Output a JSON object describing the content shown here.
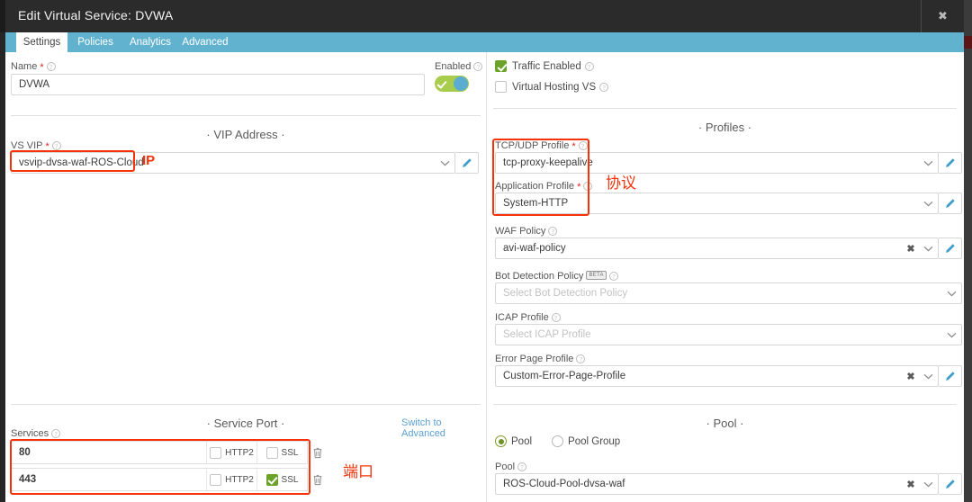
{
  "window": {
    "title": "Edit Virtual Service: DVWA",
    "close_label": "✖"
  },
  "tabs": [
    {
      "label": "Settings",
      "active": true
    },
    {
      "label": "Policies",
      "active": false
    },
    {
      "label": "Analytics",
      "active": false
    },
    {
      "label": "Advanced",
      "active": false
    }
  ],
  "name_field": {
    "label": "Name",
    "required": "*",
    "value": "DVWA"
  },
  "enabled_toggle": {
    "label": "Enabled",
    "state": "on"
  },
  "checkboxes": [
    {
      "label": "Traffic Enabled",
      "checked": true
    },
    {
      "label": "Virtual Hosting VS",
      "checked": false
    }
  ],
  "sections": {
    "vip_address": "VIP Address",
    "service_port": "Service Port",
    "profiles": "Profiles",
    "pool": "Pool"
  },
  "vs_vip": {
    "label": "VS VIP",
    "required": "*",
    "value": "vsvip-dvsa-waf-ROS-Cloud"
  },
  "service_port": {
    "services_label": "Services",
    "switch_link": "Switch to Advanced",
    "http2_label": "HTTP2",
    "ssl_label": "SSL",
    "rows": [
      {
        "port": "80",
        "http2": false,
        "ssl": false
      },
      {
        "port": "443",
        "http2": false,
        "ssl": true
      }
    ]
  },
  "profiles": {
    "tcp_udp": {
      "label": "TCP/UDP Profile",
      "required": "*",
      "value": "tcp-proxy-keepalive"
    },
    "application": {
      "label": "Application Profile",
      "required": "*",
      "value": "System-HTTP"
    },
    "waf_policy": {
      "label": "WAF Policy",
      "value": "avi-waf-policy"
    },
    "bot_detection": {
      "label": "Bot Detection Policy",
      "badge": "BETA",
      "placeholder": "Select Bot Detection Policy"
    },
    "icap": {
      "label": "ICAP Profile",
      "placeholder": "Select ICAP Profile"
    },
    "error_page": {
      "label": "Error Page Profile",
      "value": "Custom-Error-Page-Profile"
    }
  },
  "pool_section": {
    "radios": [
      {
        "label": "Pool",
        "selected": true
      },
      {
        "label": "Pool Group",
        "selected": false
      }
    ],
    "pool_field": {
      "label": "Pool",
      "value": "ROS-Cloud-Pool-dvsa-waf"
    }
  },
  "annotations": [
    {
      "text": "IP",
      "kind": "latin"
    },
    {
      "text": "协议",
      "kind": "cjk"
    },
    {
      "text": "端口",
      "kind": "cjk"
    }
  ],
  "colors": {
    "titlebar": "#2b2b2b",
    "tabstrip": "#61b2ce",
    "accent_link": "#5b9fd4",
    "toggle_on": "#a8cc4c",
    "toggle_knob": "#5aadd0",
    "checkbox_on": "#6aa328",
    "radio_on": "#6f9127",
    "annotation": "#f5320a",
    "required": "#e02020"
  }
}
